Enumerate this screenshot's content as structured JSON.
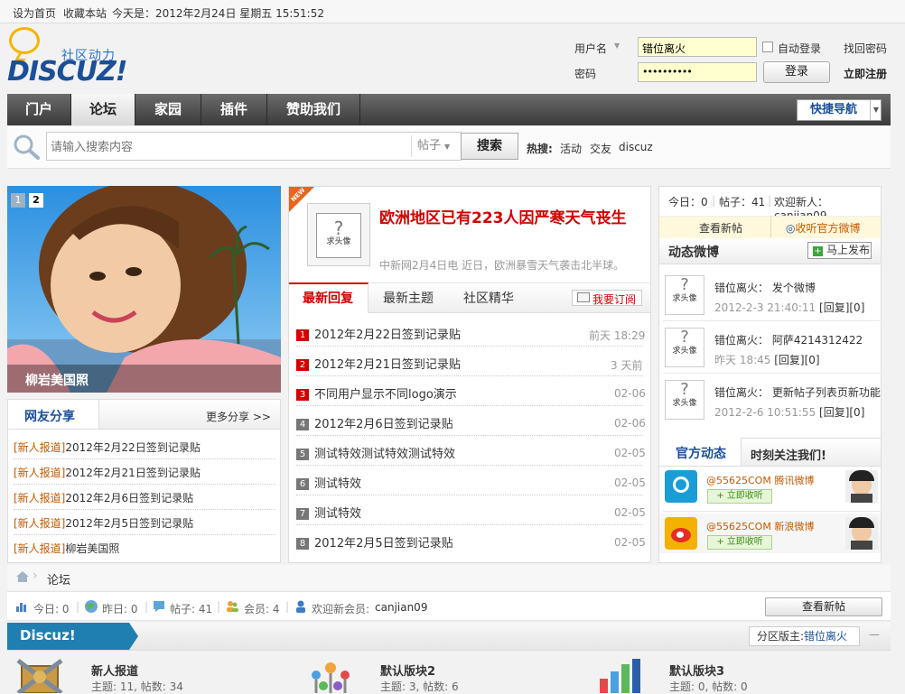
{
  "topbar": {
    "set_home": "设为首页",
    "bookmark": "收藏本站",
    "today": "今天是：2012年2月24日 星期五 15:51:52"
  },
  "logo": {
    "text": "DISCUZ!",
    "sub": "社区动力"
  },
  "login": {
    "username_label": "用户名",
    "username_value": "错位离火",
    "password_label": "密码",
    "password_value": "••••••••••",
    "auto_login": "自动登录",
    "find_password": "找回密码",
    "login_button": "登录",
    "register": "立即注册"
  },
  "nav": {
    "items": [
      {
        "label": "门户"
      },
      {
        "label": "论坛"
      },
      {
        "label": "家园"
      },
      {
        "label": "插件"
      },
      {
        "label": "赞助我们"
      }
    ],
    "quick_nav": "快捷导航"
  },
  "search": {
    "placeholder": "请输入搜索内容",
    "type": "帖子",
    "button": "搜索",
    "hot_label": "热搜:",
    "hot": [
      "活动",
      "交友",
      "discuz"
    ]
  },
  "slideshow": {
    "pages": [
      "1",
      "2"
    ],
    "caption": "柳岩美国照"
  },
  "share": {
    "title": "网友分享",
    "more": "更多分享 >>",
    "items": [
      {
        "tag": "[新人报道]",
        "text": "2012年2月22日签到记录贴"
      },
      {
        "tag": "[新人报道]",
        "text": "2012年2月21日签到记录贴"
      },
      {
        "tag": "[新人报道]",
        "text": "2012年2月6日签到记录贴"
      },
      {
        "tag": "[新人报道]",
        "text": "2012年2月5日签到记录贴"
      },
      {
        "tag": "[新人报道]",
        "text": "柳岩美国照"
      }
    ]
  },
  "headline": {
    "badge": "NEW",
    "avatar_text": "求头像",
    "title": "欧洲地区已有223人因严寒天气丧生",
    "summary": "中新网2月4日电 近日，欧洲暴雪天气袭击北半球。"
  },
  "center_tabs": {
    "tabs": [
      "最新回复",
      "最新主题",
      "社区精华"
    ],
    "subscribe": "我要订阅"
  },
  "threads": [
    {
      "n": "1",
      "title": "2012年2月22日签到记录贴",
      "time": "前天 18:29"
    },
    {
      "n": "2",
      "title": "2012年2月21日签到记录贴",
      "time": "3 天前"
    },
    {
      "n": "3",
      "title": "不同用户显示不同logo演示",
      "time": "02-06"
    },
    {
      "n": "4",
      "title": "2012年2月6日签到记录贴",
      "time": "02-06"
    },
    {
      "n": "5",
      "title": "测试特效测试特效测试特效",
      "time": "02-05"
    },
    {
      "n": "6",
      "title": "测试特效",
      "time": "02-05"
    },
    {
      "n": "7",
      "title": "测试特效",
      "time": "02-05"
    },
    {
      "n": "8",
      "title": "2012年2月5日签到记录贴",
      "time": "02-05"
    }
  ],
  "stats_right": {
    "today": "今日：0",
    "posts": "帖子：41",
    "welcome": "欢迎新人：canjian09",
    "view_new": "查看新帖",
    "follow_weibo": "收听官方微博"
  },
  "weibo": {
    "title": "动态微博",
    "publish": "马上发布",
    "avatar_text": "求头像",
    "items": [
      {
        "user": "错位离火：",
        "text": "发个微博",
        "time": "2012-2-3 21:40:11",
        "reply": "[回复][0]"
      },
      {
        "user": "错位离火：",
        "text": "阿萨4214312422",
        "time": "昨天 18:45",
        "reply": "[回复][0]"
      },
      {
        "user": "错位离火：",
        "text": "更新帖子列表页新功能",
        "time": "2012-2-6 10:51:55",
        "reply": "[回复][0]"
      }
    ]
  },
  "official": {
    "tab": "官方动态",
    "follow": "时刻关注我们!",
    "items": [
      {
        "id": "@55625COM",
        "name": "腾讯微博",
        "btn": "+ 立即收听"
      },
      {
        "id": "@55625COM",
        "name": "新浪微博",
        "btn": "+ 立即收听"
      }
    ]
  },
  "breadcrumb": {
    "current": "论坛"
  },
  "forum_stats": {
    "today": "今日: 0",
    "yesterday": "昨日: 0",
    "posts": "帖子: 41",
    "members": "会员: 4",
    "welcome_label": "欢迎新会员:",
    "welcome_user": "canjian09",
    "view_new": "查看新帖"
  },
  "category": {
    "name": "Discuz!",
    "moderator_label": "分区版主:",
    "moderator": "错位离火",
    "collapse": "—"
  },
  "forums": [
    {
      "name": "新人报道",
      "stats": "主题: 11, 帖数: 34"
    },
    {
      "name": "默认版块2",
      "stats": "主题: 3, 帖数: 6"
    },
    {
      "name": "默认版块3",
      "stats": "主题: 0, 帖数: 0"
    }
  ],
  "colors": {
    "accent": "#1c4f99",
    "nav_dark": "#3a3a3a",
    "headline_red": "#d40000",
    "tag_orange": "#c55a00",
    "category_bar": "#1e7fb0"
  }
}
